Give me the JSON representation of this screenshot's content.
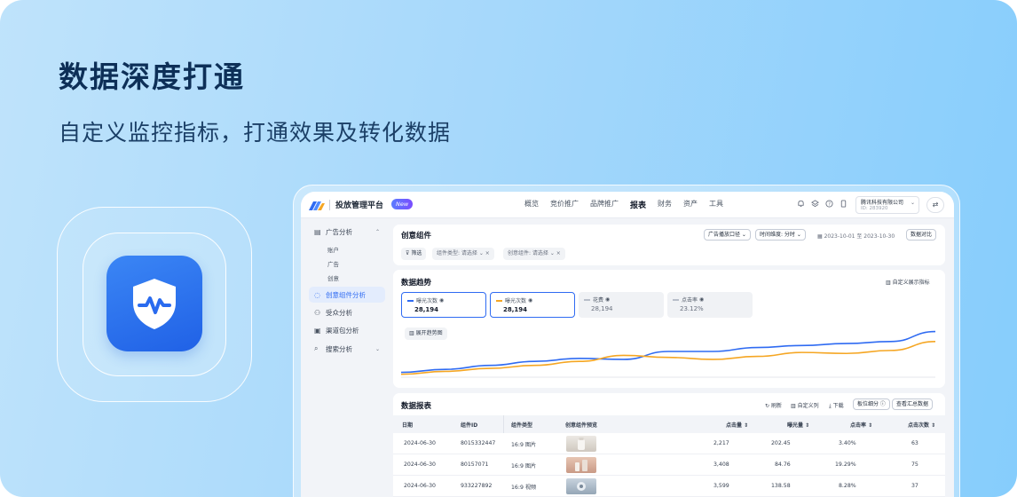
{
  "hero": {
    "title": "数据深度打通",
    "subtitle": "自定义监控指标，打通效果及转化数据"
  },
  "colors": {
    "accent": "#2f6bf2",
    "series_primary": "#2f6bf2",
    "series_secondary": "#f5a623",
    "background_gradient": [
      "#bfe3fb",
      "#86cdfc"
    ]
  },
  "app_icon": "shield-pulse-icon",
  "topbar": {
    "brand": "投放管理平台",
    "badge": "New",
    "nav": [
      "概览",
      "竞价推广",
      "品牌推广",
      "报表",
      "财务",
      "资产",
      "工具"
    ],
    "active_nav": "报表",
    "icons": [
      "bell-icon",
      "layers-icon",
      "help-icon",
      "phone-icon"
    ],
    "account_name": "腾讯科技有限公司",
    "account_id": "ID: 283920",
    "switch_icon": "swap-icon"
  },
  "sidebar": {
    "groups": [
      {
        "label": "广告分析",
        "icon": "doc-icon",
        "expanded": true,
        "children": [
          "账户",
          "广告",
          "创意"
        ]
      },
      {
        "label": "创意组件分析",
        "icon": "bulb-icon",
        "active": true
      },
      {
        "label": "受众分析",
        "icon": "people-icon"
      },
      {
        "label": "渠道包分析",
        "icon": "package-icon"
      },
      {
        "label": "搜索分析",
        "icon": "search-icon",
        "collapsible": true
      }
    ]
  },
  "filters": {
    "title": "创意组件",
    "dropdown_caliber": "广告播放口径",
    "dropdown_granularity": "时间维度: 分时",
    "date_range": "2023-10-01 至 2023-10-30",
    "compare_button": "数据对比",
    "filter_button": "筛选",
    "chip_type": "组件类型: 请选择",
    "chip_component": "创意组件: 请选择"
  },
  "trend": {
    "title": "数据趋势",
    "custom_metric_button": "自定义展示指标",
    "expand_button": "展开趋势图",
    "metrics": [
      {
        "label": "曝光次数",
        "value": "28,194",
        "selected": true,
        "color": "#2f6bf2"
      },
      {
        "label": "曝光次数",
        "value": "28,194",
        "selected": true,
        "color": "#f5a623"
      },
      {
        "label": "花费",
        "value": "28,194",
        "selected": false
      },
      {
        "label": "点击率",
        "value": "23.12%",
        "selected": false
      }
    ]
  },
  "chart_data": {
    "type": "line",
    "title": "",
    "xlabel": "",
    "ylabel": "",
    "x": [
      0,
      1,
      2,
      3,
      4,
      5,
      6,
      7,
      8,
      9,
      10,
      11,
      12
    ],
    "ylim": [
      0,
      100
    ],
    "grid": false,
    "series": [
      {
        "values": [
          8,
          14,
          22,
          30,
          36,
          34,
          50,
          50,
          58,
          62,
          66,
          70,
          90
        ]
      },
      {
        "values": [
          4,
          10,
          16,
          22,
          30,
          42,
          38,
          34,
          40,
          48,
          46,
          52,
          70
        ]
      }
    ]
  },
  "report": {
    "title": "数据报表",
    "actions": [
      "刷新",
      "自定义列",
      "下载",
      "板位细分",
      "查看汇总数据"
    ],
    "columns": [
      "日期",
      "组件ID",
      "组件类型",
      "创意组件预览",
      "点击量",
      "曝光量",
      "点击率",
      "点击次数"
    ],
    "rows": [
      {
        "date": "2024-06-30",
        "id": "8015332447",
        "type": "16:9 图片",
        "clicks": "2,217",
        "impressions": "202.45",
        "ctr": "3.40%",
        "click_count": "63"
      },
      {
        "date": "2024-06-30",
        "id": "80157071",
        "type": "16:9 图片",
        "clicks": "3,408",
        "impressions": "84.76",
        "ctr": "19.29%",
        "click_count": "75"
      },
      {
        "date": "2024-06-30",
        "id": "933227892",
        "type": "16:9 视频",
        "clicks": "3,599",
        "impressions": "138.58",
        "ctr": "8.28%",
        "click_count": "37"
      }
    ]
  }
}
